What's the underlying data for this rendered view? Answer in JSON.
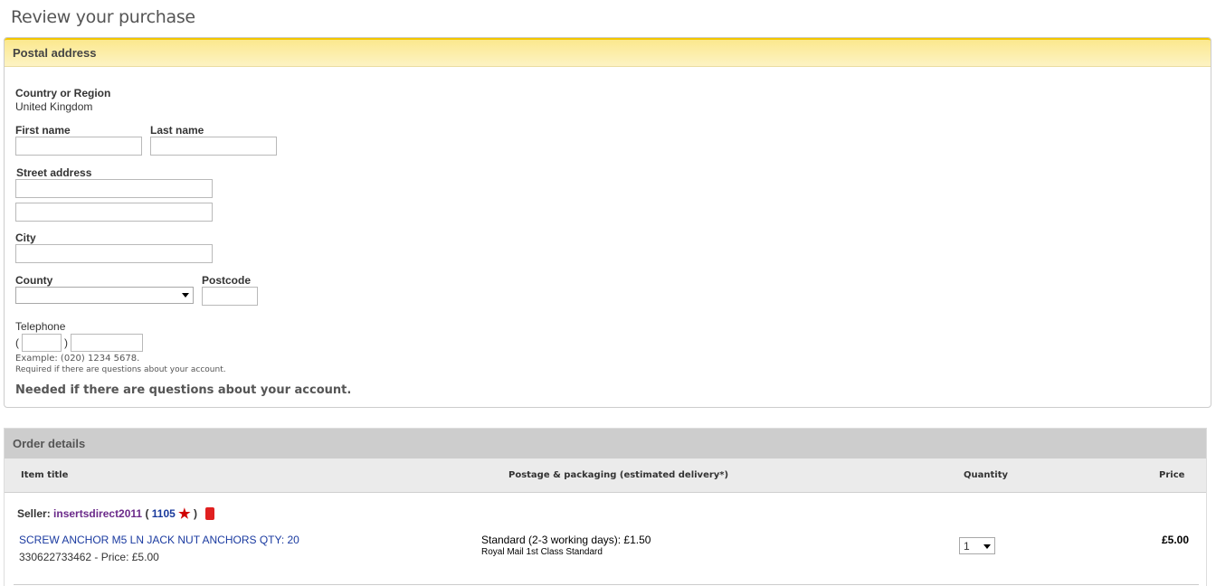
{
  "page": {
    "title": "Review your purchase"
  },
  "postal": {
    "header": "Postal address",
    "country_label": "Country or Region",
    "country_value": "United Kingdom",
    "first_name_label": "First name",
    "first_name_value": "",
    "last_name_label": "Last name",
    "last_name_value": "",
    "street_label": "Street address",
    "street1_value": "",
    "street2_value": "",
    "city_label": "City",
    "city_value": "",
    "county_label": "County",
    "county_value": "",
    "postcode_label": "Postcode",
    "postcode_value": "",
    "telephone_label": "Telephone",
    "paren_open": "(",
    "paren_close": ")",
    "phone_example": "Example: (020) 1234 5678.",
    "phone_required": "Required if there are questions about your account.",
    "needed_note": "Needed if there are questions about your account."
  },
  "order": {
    "header": "Order details",
    "columns": {
      "item_title": "Item title",
      "postage": "Postage & packaging (estimated delivery*)",
      "quantity": "Quantity",
      "price": "Price"
    },
    "seller_prefix": "Seller:",
    "seller_name": "insertsdirect2011",
    "seller_open": "(",
    "seller_score": "1105",
    "seller_close": ")",
    "star_icon": "red-star-icon",
    "shop_icon": "red-shop-icon",
    "item": {
      "title": "SCREW ANCHOR M5 LN JACK NUT ANCHORS QTY: 20",
      "id_price": "330622733462 - Price: £5.00",
      "shipping": "Standard (2-3 working days): £1.50",
      "carrier": "Royal Mail 1st Class Standard",
      "quantity": "1",
      "price": "£5.00"
    }
  }
}
